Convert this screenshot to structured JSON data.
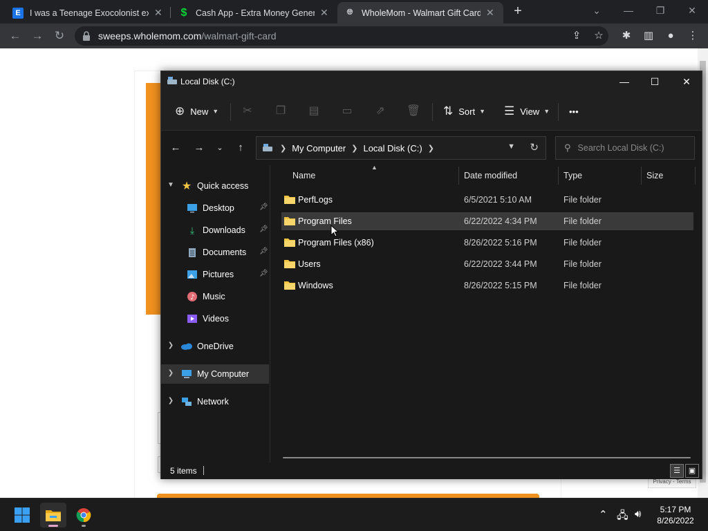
{
  "browser": {
    "tabs": [
      {
        "title": "I was a Teenage Exocolonist expl",
        "favicon": "e-icon",
        "active": false
      },
      {
        "title": "Cash App - Extra Money Generat",
        "favicon": "dollar-icon",
        "active": false
      },
      {
        "title": "WholeMom - Walmart Gift Card",
        "favicon": "globe-icon",
        "active": true
      }
    ],
    "url_host": "sweeps.wholemom.com",
    "url_path": "/walmart-gift-card"
  },
  "page": {
    "recaptcha_text": "Privacy - Terms"
  },
  "explorer": {
    "title": "Local Disk (C:)",
    "commands": {
      "new_label": "New",
      "sort_label": "Sort",
      "view_label": "View",
      "more_label": "•••"
    },
    "breadcrumbs": [
      "My Computer",
      "Local Disk (C:)"
    ],
    "search_placeholder": "Search Local Disk (C:)",
    "nav": {
      "quick_access": "Quick access",
      "items": [
        {
          "label": "Desktop",
          "icon": "desktop-icon",
          "pinned": true
        },
        {
          "label": "Downloads",
          "icon": "download-icon",
          "pinned": true
        },
        {
          "label": "Documents",
          "icon": "document-icon",
          "pinned": true
        },
        {
          "label": "Pictures",
          "icon": "picture-icon",
          "pinned": true
        },
        {
          "label": "Music",
          "icon": "music-icon",
          "pinned": false
        },
        {
          "label": "Videos",
          "icon": "video-icon",
          "pinned": false
        }
      ],
      "onedrive": "OneDrive",
      "my_computer": "My Computer",
      "network": "Network"
    },
    "columns": {
      "name": "Name",
      "date": "Date modified",
      "type": "Type",
      "size": "Size"
    },
    "files": [
      {
        "name": "PerfLogs",
        "date": "6/5/2021 5:10 AM",
        "type": "File folder"
      },
      {
        "name": "Program Files",
        "date": "6/22/2022 4:34 PM",
        "type": "File folder"
      },
      {
        "name": "Program Files (x86)",
        "date": "8/26/2022 5:16 PM",
        "type": "File folder"
      },
      {
        "name": "Users",
        "date": "6/22/2022 3:44 PM",
        "type": "File folder"
      },
      {
        "name": "Windows",
        "date": "8/26/2022 5:15 PM",
        "type": "File folder"
      }
    ],
    "status": "5 items"
  },
  "taskbar": {
    "time": "5:17 PM",
    "date": "8/26/2022"
  },
  "colors": {
    "explorer_bg": "#191919",
    "accent_orange": "#f0901e",
    "folder_yellow": "#f4c542"
  }
}
